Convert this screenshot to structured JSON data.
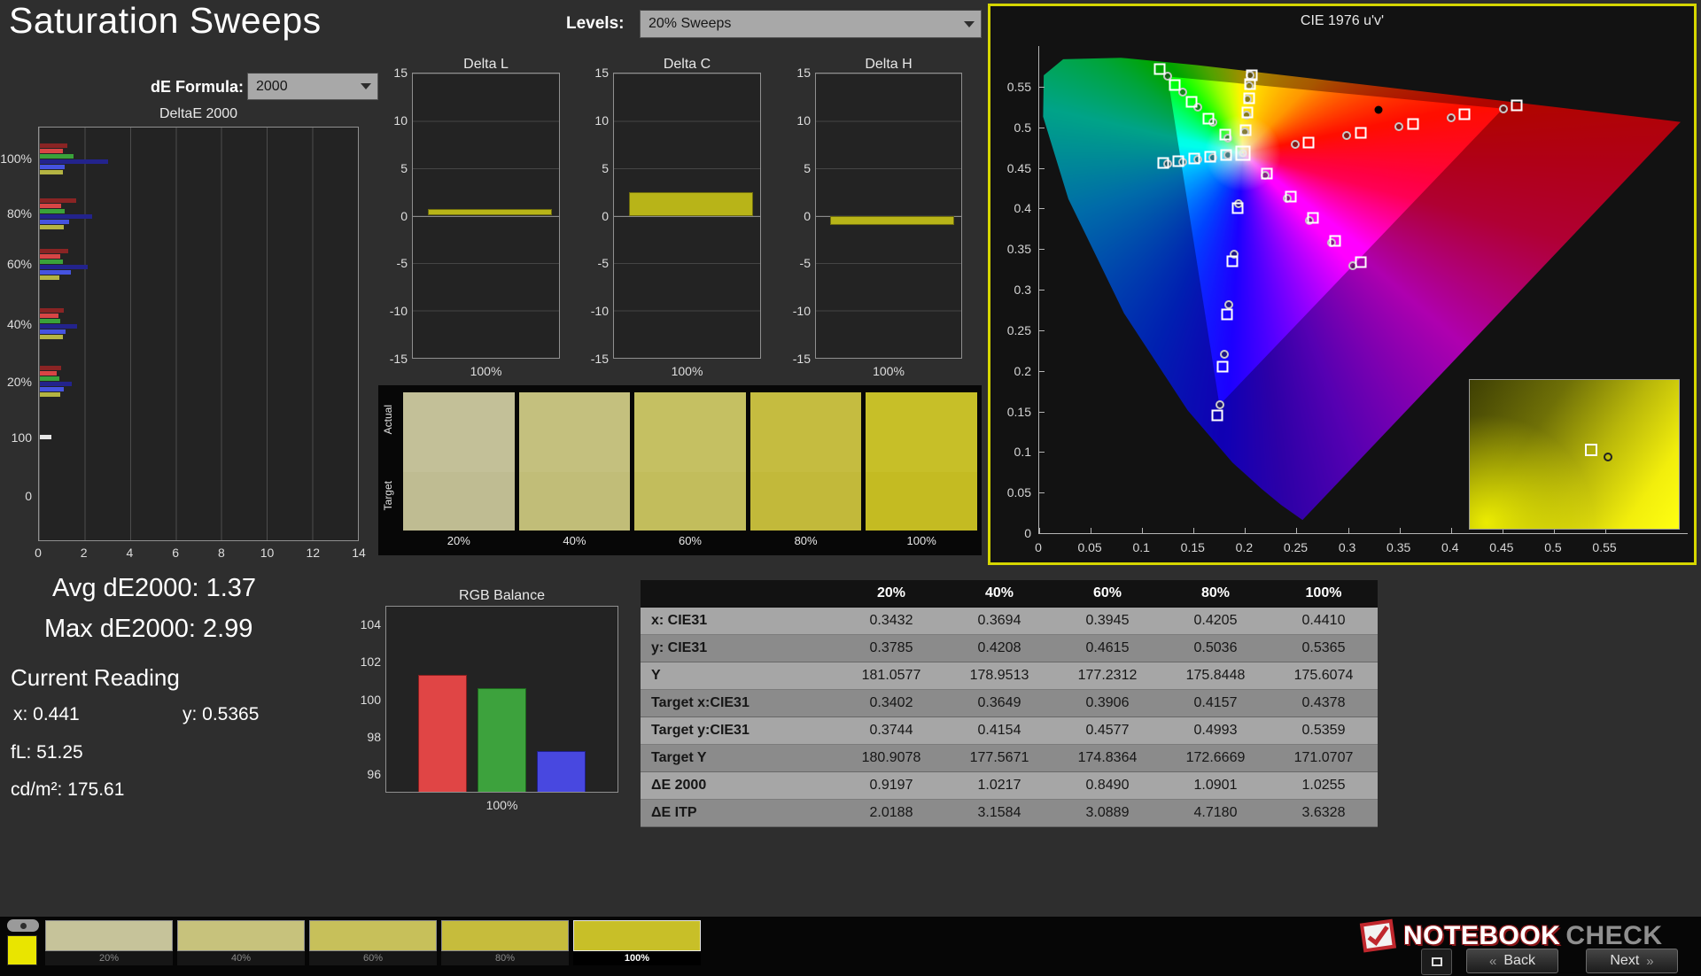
{
  "header": {
    "title": "Saturation Sweeps",
    "levels_label": "Levels:",
    "levels_value": "20% Sweeps",
    "de_formula_label": "dE Formula:",
    "de_formula_value": "2000"
  },
  "stats": {
    "avg": "Avg dE2000: 1.37",
    "max": "Max dE2000: 2.99",
    "current_reading": "Current Reading",
    "x": "x: 0.441",
    "y": "y: 0.5365",
    "fl": "fL: 51.25",
    "cdm2": "cd/m²: 175.61"
  },
  "chart_data": [
    {
      "id": "deltae2000",
      "type": "bar",
      "title": "DeltaE 2000",
      "orientation": "horizontal",
      "xlim": [
        0,
        14
      ],
      "x_ticks": [
        0,
        2,
        4,
        6,
        8,
        10,
        12,
        14
      ],
      "groups": [
        {
          "label": "100%",
          "values": [
            1.2,
            1.0,
            1.5,
            2.99,
            1.1,
            1.0
          ],
          "colors": [
            "#8a2424",
            "#d84545",
            "#3aa23a",
            "#23238c",
            "#4553e0",
            "#b4b443"
          ]
        },
        {
          "label": "80%",
          "values": [
            1.6,
            0.95,
            1.1,
            2.3,
            1.3,
            1.05
          ],
          "colors": [
            "#8a2424",
            "#d84545",
            "#3aa23a",
            "#23238c",
            "#4553e0",
            "#b4b443"
          ]
        },
        {
          "label": "60%",
          "values": [
            1.25,
            0.9,
            1.0,
            2.1,
            1.35,
            0.85
          ],
          "colors": [
            "#8a2424",
            "#d84545",
            "#3aa23a",
            "#23238c",
            "#4553e0",
            "#b4b443"
          ]
        },
        {
          "label": "40%",
          "values": [
            1.05,
            0.8,
            0.9,
            1.65,
            1.15,
            1.0
          ],
          "colors": [
            "#8a2424",
            "#d84545",
            "#3aa23a",
            "#23238c",
            "#4553e0",
            "#b4b443"
          ]
        },
        {
          "label": "20%",
          "values": [
            0.95,
            0.75,
            0.85,
            1.4,
            1.05,
            0.9
          ],
          "colors": [
            "#8a2424",
            "#d84545",
            "#3aa23a",
            "#23238c",
            "#4553e0",
            "#b4b443"
          ]
        },
        {
          "label": "100",
          "values": [
            0.5
          ],
          "colors": [
            "#e6e6e6"
          ]
        },
        {
          "label": "0",
          "values": [],
          "colors": []
        }
      ]
    },
    {
      "id": "delta_l",
      "type": "bar",
      "title": "Delta L",
      "categories": [
        "100%"
      ],
      "values": [
        0.7
      ],
      "ylim": [
        -15,
        15
      ],
      "y_ticks": [
        "15",
        "10",
        "5",
        "0",
        "-5",
        "-10",
        "-15"
      ],
      "bar_color": "#b8b418",
      "bar_border": "#6f6c0e"
    },
    {
      "id": "delta_c",
      "type": "bar",
      "title": "Delta C",
      "categories": [
        "100%"
      ],
      "values": [
        2.5
      ],
      "ylim": [
        -15,
        15
      ],
      "y_ticks": [
        "15",
        "10",
        "5",
        "0",
        "-5",
        "-10",
        "-15"
      ],
      "bar_color": "#b8b418",
      "bar_border": "#6f6c0e"
    },
    {
      "id": "delta_h",
      "type": "bar",
      "title": "Delta H",
      "categories": [
        "100%"
      ],
      "values": [
        -1.0
      ],
      "ylim": [
        -15,
        15
      ],
      "y_ticks": [
        "15",
        "10",
        "5",
        "0",
        "-5",
        "-10",
        "-15"
      ],
      "bar_color": "#b8b418",
      "bar_border": "#6f6c0e"
    },
    {
      "id": "rgb_balance",
      "type": "bar",
      "title": "RGB Balance",
      "categories": [
        "100%"
      ],
      "ylim": [
        95,
        105
      ],
      "y_ticks": [
        104,
        102,
        100,
        98,
        96
      ],
      "series": [
        {
          "name": "Red",
          "value": 101.3,
          "color": "#e04545",
          "border": "#8a1f1f"
        },
        {
          "name": "Green",
          "value": 100.6,
          "color": "#3da23d",
          "border": "#1d681d"
        },
        {
          "name": "Blue",
          "value": 97.2,
          "color": "#4848e0",
          "border": "#1f1f8a"
        }
      ]
    },
    {
      "id": "cie",
      "type": "scatter",
      "title": "CIE 1976 u'v'",
      "xlim": [
        0,
        0.63
      ],
      "ylim": [
        0,
        0.6
      ],
      "x_ticks": [
        "0",
        "0.05",
        "0.1",
        "0.15",
        "0.2",
        "0.25",
        "0.3",
        "0.35",
        "0.4",
        "0.45",
        "0.5",
        "0.55"
      ],
      "y_ticks": [
        "0",
        "0.05",
        "0.1",
        "0.15",
        "0.2",
        "0.25",
        "0.3",
        "0.35",
        "0.4",
        "0.45",
        "0.5",
        "0.55"
      ],
      "white_point": [
        0.198,
        0.468
      ],
      "black_dot": [
        0.33,
        0.521
      ],
      "targets": [
        [
          0.2485,
          0.479
        ],
        [
          0.299,
          0.49
        ],
        [
          0.3496,
          0.501
        ],
        [
          0.4,
          0.512
        ],
        [
          0.4507,
          0.5229
        ],
        [
          0.1834,
          0.4869
        ],
        [
          0.1688,
          0.5058
        ],
        [
          0.1542,
          0.5247
        ],
        [
          0.1396,
          0.5436
        ],
        [
          0.125,
          0.5625
        ],
        [
          0.1935,
          0.406
        ],
        [
          0.189,
          0.344
        ],
        [
          0.1845,
          0.282
        ],
        [
          0.18,
          0.22
        ],
        [
          0.1754,
          0.158
        ],
        [
          0.1834,
          0.4654
        ],
        [
          0.1688,
          0.4628
        ],
        [
          0.1542,
          0.4602
        ],
        [
          0.1396,
          0.4576
        ],
        [
          0.125,
          0.455
        ],
        [
          0.2194,
          0.4404
        ],
        [
          0.2408,
          0.4128
        ],
        [
          0.2622,
          0.3852
        ],
        [
          0.2836,
          0.3576
        ],
        [
          0.305,
          0.33
        ],
        [
          0.1998,
          0.4946
        ],
        [
          0.2012,
          0.5153
        ],
        [
          0.2026,
          0.5342
        ],
        [
          0.2038,
          0.5507
        ],
        [
          0.2047,
          0.5638
        ]
      ],
      "measured": [
        [
          0.262,
          0.4815
        ],
        [
          0.312,
          0.493
        ],
        [
          0.363,
          0.5045
        ],
        [
          0.413,
          0.5155
        ],
        [
          0.464,
          0.5265
        ],
        [
          0.1805,
          0.4905
        ],
        [
          0.164,
          0.5105
        ],
        [
          0.148,
          0.531
        ],
        [
          0.132,
          0.552
        ],
        [
          0.117,
          0.572
        ],
        [
          0.1928,
          0.4
        ],
        [
          0.1878,
          0.335
        ],
        [
          0.1828,
          0.27
        ],
        [
          0.1778,
          0.205
        ],
        [
          0.1728,
          0.145
        ],
        [
          0.1815,
          0.466
        ],
        [
          0.166,
          0.4635
        ],
        [
          0.151,
          0.461
        ],
        [
          0.1355,
          0.4585
        ],
        [
          0.1205,
          0.456
        ],
        [
          0.2215,
          0.443
        ],
        [
          0.2445,
          0.415
        ],
        [
          0.266,
          0.388
        ],
        [
          0.2875,
          0.36
        ],
        [
          0.312,
          0.334
        ],
        [
          0.2003,
          0.4969
        ],
        [
          0.2021,
          0.518
        ],
        [
          0.2036,
          0.536
        ],
        [
          0.2051,
          0.5526
        ],
        [
          0.2062,
          0.5644
        ]
      ]
    }
  ],
  "swatches": {
    "row_labels": [
      "Actual",
      "Target"
    ],
    "levels": [
      "20%",
      "40%",
      "60%",
      "80%",
      "100%"
    ],
    "actual": [
      "#c3c098",
      "#c4c07e",
      "#c5c062",
      "#c5bc40",
      "#c7bf28"
    ],
    "target": [
      "#bfbc92",
      "#c1bd78",
      "#c2bd5c",
      "#c2b93a",
      "#c4bb22"
    ]
  },
  "table": {
    "header": [
      "",
      "20%",
      "40%",
      "60%",
      "80%",
      "100%"
    ],
    "rows": [
      {
        "label": "x: CIE31",
        "values": [
          "0.3432",
          "0.3694",
          "0.3945",
          "0.4205",
          "0.4410"
        ]
      },
      {
        "label": "y: CIE31",
        "values": [
          "0.3785",
          "0.4208",
          "0.4615",
          "0.5036",
          "0.5365"
        ]
      },
      {
        "label": "Y",
        "values": [
          "181.0577",
          "178.9513",
          "177.2312",
          "175.8448",
          "175.6074"
        ]
      },
      {
        "label": "Target x:CIE31",
        "values": [
          "0.3402",
          "0.3649",
          "0.3906",
          "0.4157",
          "0.4378"
        ]
      },
      {
        "label": "Target y:CIE31",
        "values": [
          "0.3744",
          "0.4154",
          "0.4577",
          "0.4993",
          "0.5359"
        ]
      },
      {
        "label": "Target Y",
        "values": [
          "180.9078",
          "177.5671",
          "174.8364",
          "172.6669",
          "171.0707"
        ]
      },
      {
        "label": "ΔE 2000",
        "values": [
          "0.9197",
          "1.0217",
          "0.8490",
          "1.0901",
          "1.0255"
        ]
      },
      {
        "label": "ΔE ITP",
        "values": [
          "2.0188",
          "3.1584",
          "3.0889",
          "4.7180",
          "3.6328"
        ]
      }
    ]
  },
  "footer": {
    "current_color": "#e9e500",
    "tiles": [
      {
        "label": "20%",
        "color": "#c6c39a",
        "selected": false
      },
      {
        "label": "40%",
        "color": "#c7c27c",
        "selected": false
      },
      {
        "label": "60%",
        "color": "#c7c05a",
        "selected": false
      },
      {
        "label": "80%",
        "color": "#c6bc3c",
        "selected": false
      },
      {
        "label": "100%",
        "color": "#c8bf28",
        "selected": true
      }
    ],
    "logo": {
      "text1": "NOTEBOOK",
      "text2": "CHECK"
    },
    "back_chevron": "«",
    "back_label": "Back",
    "next_label": "Next",
    "next_chevron": "»"
  }
}
